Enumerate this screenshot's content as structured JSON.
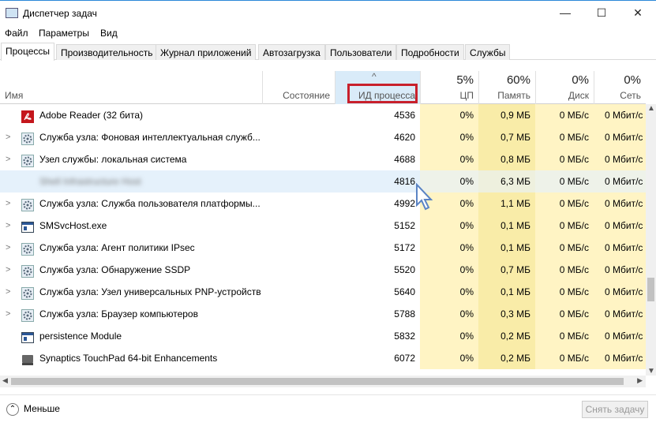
{
  "window": {
    "title": "Диспетчер задач",
    "minimize": "—",
    "maximize": "☐",
    "close": "✕"
  },
  "menu": [
    "Файл",
    "Параметры",
    "Вид"
  ],
  "tabs": [
    "Процессы",
    "Производительность",
    "Журнал приложений",
    "Автозагрузка",
    "Пользователи",
    "Подробности",
    "Службы"
  ],
  "columns": {
    "name": "Имя",
    "state": "Состояние",
    "pid": "ИД процесса",
    "sort_arrow": "^",
    "cpu_pct": "5%",
    "cpu": "ЦП",
    "mem_pct": "60%",
    "mem": "Память",
    "disk_pct": "0%",
    "disk": "Диск",
    "net_pct": "0%",
    "net": "Сеть"
  },
  "rows": [
    {
      "name": "Adobe Reader (32 бита)",
      "pid": "4536",
      "cpu": "0%",
      "mem": "0,9 МБ",
      "disk": "0 МБ/с",
      "net": "0 Мбит/с",
      "icon": "pdf",
      "exp": false
    },
    {
      "name": "Служба узла: Фоновая интеллектуальная служб...",
      "pid": "4620",
      "cpu": "0%",
      "mem": "0,7 МБ",
      "disk": "0 МБ/с",
      "net": "0 Мбит/с",
      "icon": "gear",
      "exp": true
    },
    {
      "name": "Узел службы: локальная система",
      "pid": "4688",
      "cpu": "0%",
      "mem": "0,8 МБ",
      "disk": "0 МБ/с",
      "net": "0 Мбит/с",
      "icon": "gear",
      "exp": true
    },
    {
      "name": "Shell Infrastructure Host",
      "pid": "4816",
      "cpu": "0%",
      "mem": "6,3 МБ",
      "disk": "0 МБ/с",
      "net": "0 Мбит/с",
      "icon": "blank",
      "exp": false,
      "selected": true,
      "blurred": true
    },
    {
      "name": "Служба узла: Служба пользователя платформы...",
      "pid": "4992",
      "cpu": "0%",
      "mem": "1,1 МБ",
      "disk": "0 МБ/с",
      "net": "0 Мбит/с",
      "icon": "gear",
      "exp": true
    },
    {
      "name": "SMSvcHost.exe",
      "pid": "5152",
      "cpu": "0%",
      "mem": "0,1 МБ",
      "disk": "0 МБ/с",
      "net": "0 Мбит/с",
      "icon": "window",
      "exp": true
    },
    {
      "name": "Служба узла: Агент политики IPsec",
      "pid": "5172",
      "cpu": "0%",
      "mem": "0,1 МБ",
      "disk": "0 МБ/с",
      "net": "0 Мбит/с",
      "icon": "gear",
      "exp": true
    },
    {
      "name": "Служба узла: Обнаружение SSDP",
      "pid": "5520",
      "cpu": "0%",
      "mem": "0,7 МБ",
      "disk": "0 МБ/с",
      "net": "0 Мбит/с",
      "icon": "gear",
      "exp": true
    },
    {
      "name": "Служба узла: Узел универсальных PNP-устройств",
      "pid": "5640",
      "cpu": "0%",
      "mem": "0,1 МБ",
      "disk": "0 МБ/с",
      "net": "0 Мбит/с",
      "icon": "gear",
      "exp": true
    },
    {
      "name": "Служба узла: Браузер компьютеров",
      "pid": "5788",
      "cpu": "0%",
      "mem": "0,3 МБ",
      "disk": "0 МБ/с",
      "net": "0 Мбит/с",
      "icon": "gear",
      "exp": true
    },
    {
      "name": "persistence Module",
      "pid": "5832",
      "cpu": "0%",
      "mem": "0,2 МБ",
      "disk": "0 МБ/с",
      "net": "0 Мбит/с",
      "icon": "window",
      "exp": false
    },
    {
      "name": "Synaptics TouchPad 64-bit Enhancements",
      "pid": "6072",
      "cpu": "0%",
      "mem": "0,2 МБ",
      "disk": "0 МБ/с",
      "net": "0 Мбит/с",
      "icon": "touchpad",
      "exp": false
    }
  ],
  "footer": {
    "less": "Меньше",
    "end_task": "Снять задачу"
  }
}
